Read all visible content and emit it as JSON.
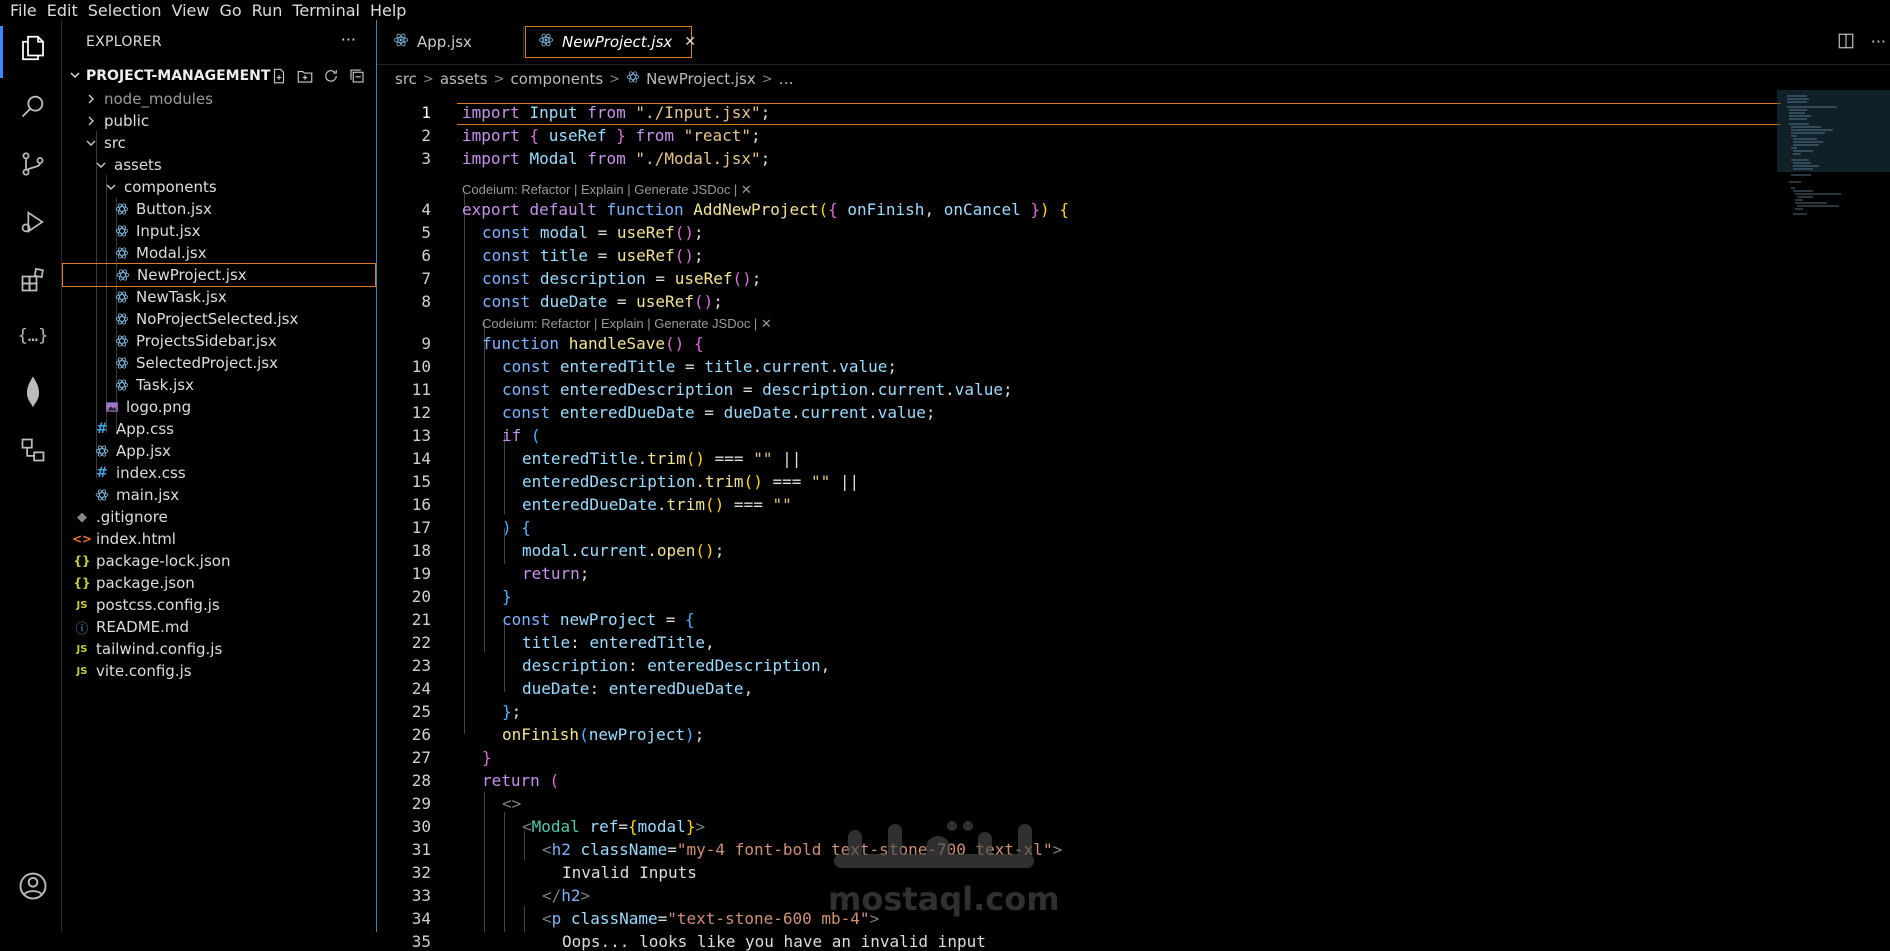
{
  "menu": [
    "File",
    "Edit",
    "Selection",
    "View",
    "Go",
    "Run",
    "Terminal",
    "Help"
  ],
  "activity_bar": {
    "items": [
      "explorer-icon",
      "search-icon",
      "source-control-icon",
      "run-debug-icon",
      "extensions-icon",
      "json-icon",
      "mongodb-icon",
      "remote-explorer-icon"
    ],
    "bottom": "account-icon"
  },
  "explorer": {
    "title": "EXPLORER",
    "more": "···",
    "project": "PROJECT-MANAGEMENT",
    "tree": [
      {
        "label": "node_modules",
        "type": "folder-closed",
        "dim": true
      },
      {
        "label": "public",
        "type": "folder-closed"
      },
      {
        "label": "src",
        "type": "folder-open"
      },
      {
        "label": "assets",
        "type": "folder-open"
      },
      {
        "label": "components",
        "type": "folder-open"
      },
      {
        "label": "Button.jsx",
        "type": "react"
      },
      {
        "label": "Input.jsx",
        "type": "react"
      },
      {
        "label": "Modal.jsx",
        "type": "react"
      },
      {
        "label": "NewProject.jsx",
        "type": "react",
        "selected": true
      },
      {
        "label": "NewTask.jsx",
        "type": "react"
      },
      {
        "label": "NoProjectSelected.jsx",
        "type": "react"
      },
      {
        "label": "ProjectsSidebar.jsx",
        "type": "react"
      },
      {
        "label": "SelectedProject.jsx",
        "type": "react"
      },
      {
        "label": "Task.jsx",
        "type": "react"
      },
      {
        "label": "logo.png",
        "type": "image"
      },
      {
        "label": "App.css",
        "type": "css"
      },
      {
        "label": "App.jsx",
        "type": "react"
      },
      {
        "label": "index.css",
        "type": "css"
      },
      {
        "label": "main.jsx",
        "type": "react"
      },
      {
        "label": ".gitignore",
        "type": "git"
      },
      {
        "label": "index.html",
        "type": "html"
      },
      {
        "label": "package-lock.json",
        "type": "json"
      },
      {
        "label": "package.json",
        "type": "json"
      },
      {
        "label": "postcss.config.js",
        "type": "js"
      },
      {
        "label": "README.md",
        "type": "info"
      },
      {
        "label": "tailwind.config.js",
        "type": "js"
      },
      {
        "label": "vite.config.js",
        "type": "js"
      }
    ]
  },
  "tabs": [
    {
      "label": "App.jsx",
      "active": false
    },
    {
      "label": "NewProject.jsx",
      "active": true
    }
  ],
  "breadcrumb": [
    "src",
    "assets",
    "components",
    "NewProject.jsx",
    "…"
  ],
  "codelens": "Codeium: Refactor | Explain | Generate JSDoc | ✕",
  "code": {
    "l1": "import Input from \"./Input.jsx\";",
    "l2": "import { useRef } from \"react\";",
    "l3": "import Modal from \"./Modal.jsx\";",
    "l4": "export default function AddNewProject({ onFinish, onCancel }) {",
    "l5": "const modal = useRef();",
    "l6": "const title = useRef();",
    "l7": "const description = useRef();",
    "l8": "const dueDate = useRef();",
    "l9": "function handleSave() {",
    "l10": "const enteredTitle = title.current.value;",
    "l11": "const enteredDescription = description.current.value;",
    "l12": "const enteredDueDate = dueDate.current.value;",
    "l13": "if (",
    "l14": "enteredTitle.trim() === \"\" ||",
    "l15": "enteredDescription.trim() === \"\" ||",
    "l16": "enteredDueDate.trim() === \"\"",
    "l17": ") {",
    "l18": "modal.current.open();",
    "l19": "return;",
    "l20": "}",
    "l21": "const newProject = {",
    "l22": "title: enteredTitle,",
    "l23": "description: enteredDescription,",
    "l24": "dueDate: enteredDueDate,",
    "l25": "};",
    "l26": "onFinish(newProject);",
    "l27": "}",
    "l28": "return (",
    "l29": "<>",
    "l30": "<Modal ref={modal}>",
    "l31": "<h2 className=\"my-4 font-bold text-stone-700 text-xl\">",
    "l32": "Invalid Inputs",
    "l33": "</h2>",
    "l34": "<p className=\"text-stone-600 mb-4\">",
    "l35": "Oops... looks like you have an invalid input"
  },
  "line_numbers": [
    "1",
    "2",
    "3",
    "4",
    "5",
    "6",
    "7",
    "8",
    "9",
    "10",
    "11",
    "12",
    "13",
    "14",
    "15",
    "16",
    "17",
    "18",
    "19",
    "20",
    "21",
    "22",
    "23",
    "24",
    "25",
    "26",
    "27",
    "28",
    "29",
    "30",
    "31",
    "32",
    "33",
    "34",
    "35"
  ],
  "watermark": {
    "text": "mostaql.com",
    "logo_text": "مستقل"
  },
  "colors": {
    "accent": "#e07a1e",
    "sidebar_border": "#1e90b0",
    "background": "#000000"
  }
}
